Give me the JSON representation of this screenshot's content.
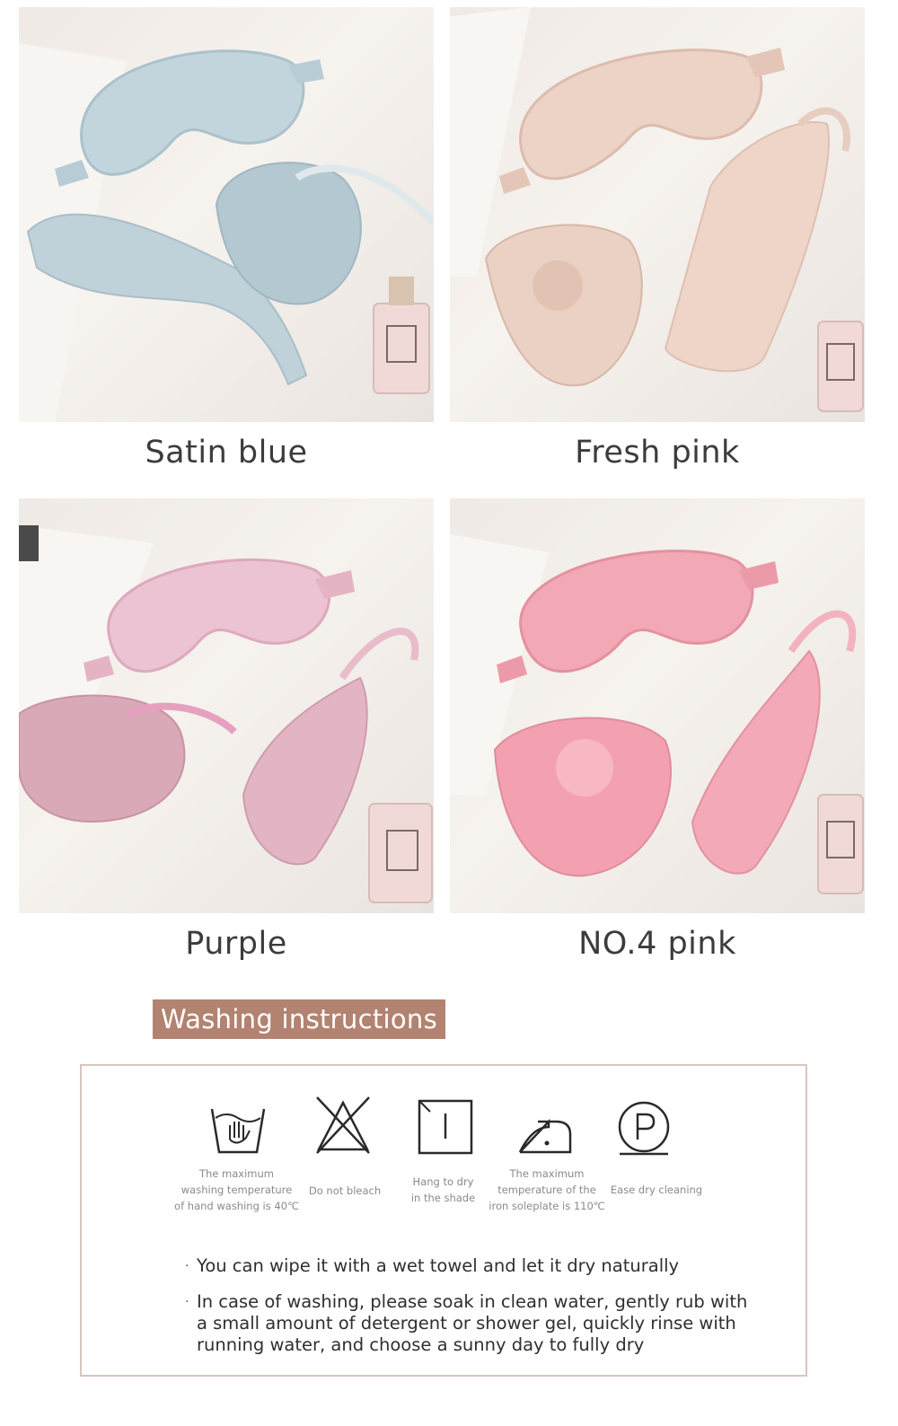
{
  "products": [
    {
      "label": "Satin blue",
      "color": "#c9d9df"
    },
    {
      "label": "Fresh pink",
      "color": "#ecd2c6"
    },
    {
      "label": "Purple",
      "color": "#e9bccd"
    },
    {
      "label": "NO.4 pink",
      "color": "#f2a9b5"
    }
  ],
  "washing": {
    "title": "Washing instructions",
    "icons": [
      {
        "icon": "hand-wash-icon",
        "label_lines": [
          "The maximum",
          "washing temperature",
          "of hand washing is 40℃"
        ]
      },
      {
        "icon": "no-bleach-icon",
        "label_lines": [
          "Do not bleach"
        ]
      },
      {
        "icon": "dry-in-shade-icon",
        "label_lines": [
          "Hang to dry",
          "in the shade"
        ]
      },
      {
        "icon": "iron-icon",
        "label_lines": [
          "The maximum",
          "temperature of the",
          "iron soleplate is 110℃"
        ]
      },
      {
        "icon": "dry-clean-icon",
        "label_lines": [
          "Ease dry cleaning"
        ]
      }
    ],
    "bullets": [
      {
        "lines": [
          "You can wipe it with a wet towel and let it dry naturally"
        ]
      },
      {
        "lines": [
          "In case of washing, please soak in clean water, gently rub with",
          "a small amount of detergent or shower gel, quickly rinse with",
          "running water, and choose a sunny day to fully dry"
        ]
      }
    ],
    "bullet_mark": "·",
    "accent_color": "#b28370",
    "border_color": "#d9c5bb"
  }
}
